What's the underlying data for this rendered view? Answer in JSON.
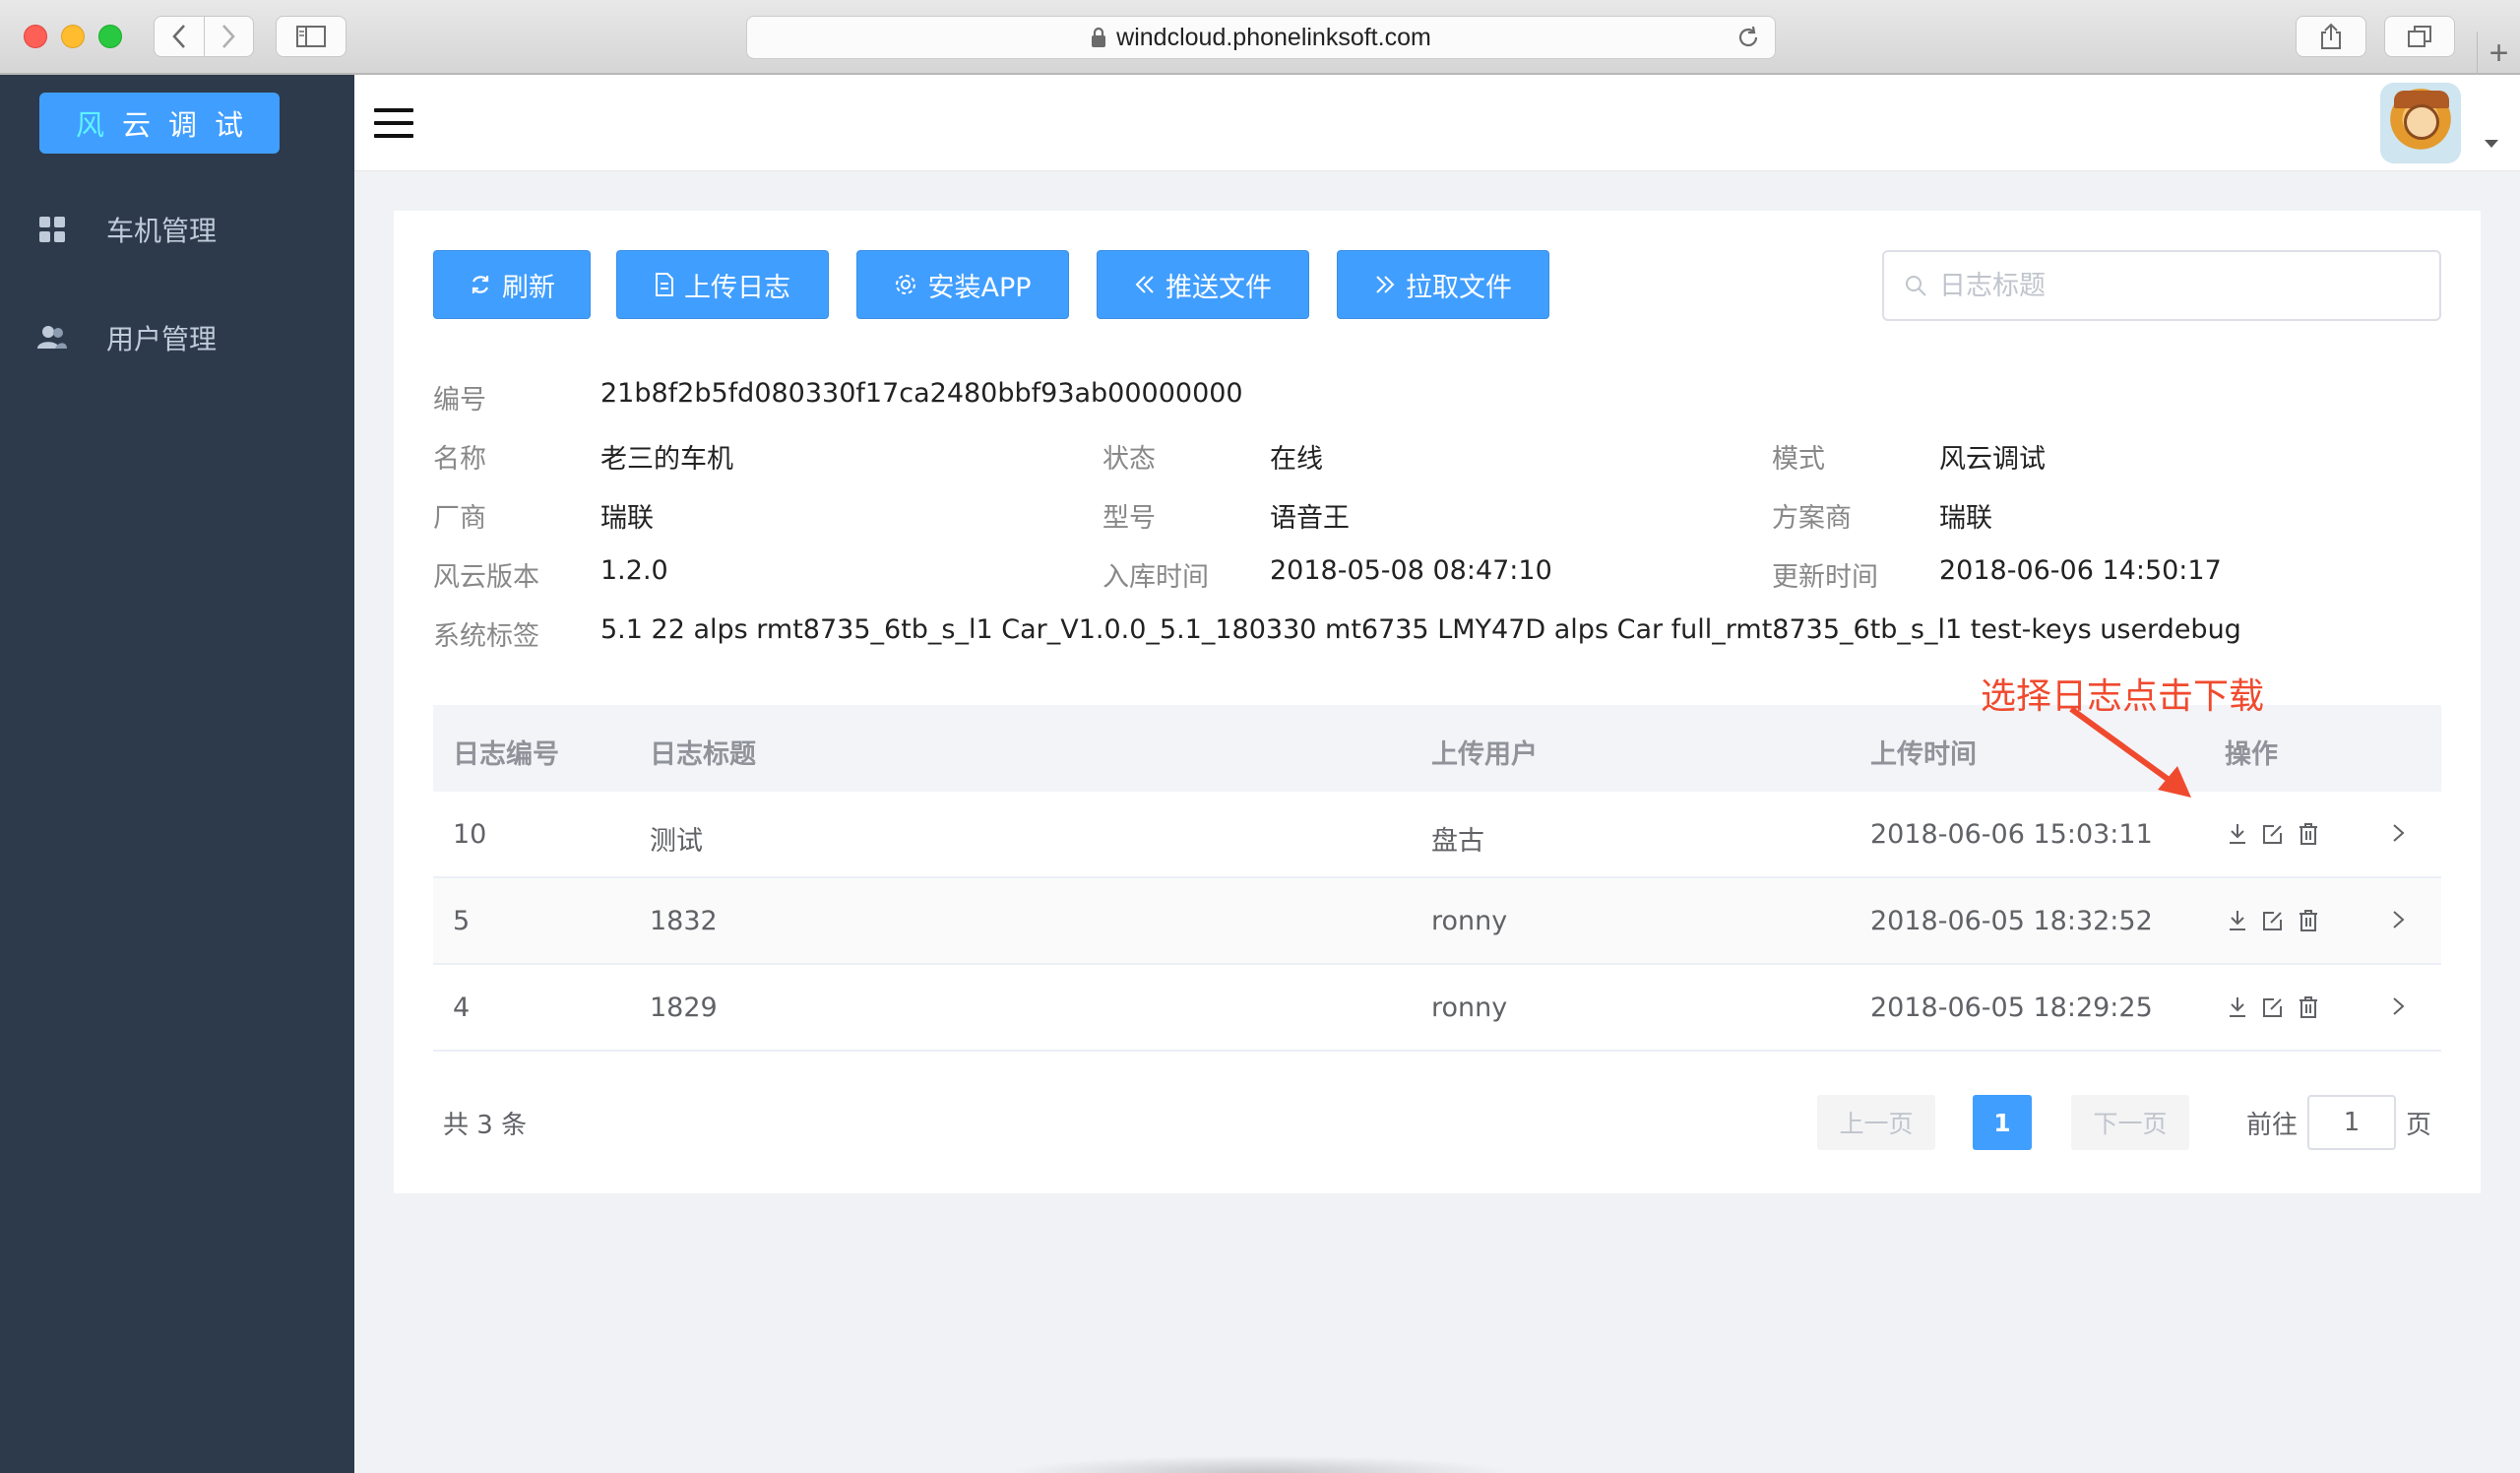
{
  "browser": {
    "url": "windcloud.phonelinksoft.com",
    "new_tab": "+"
  },
  "sidebar": {
    "brand": {
      "first": "风",
      "rest": "云调试"
    },
    "items": [
      {
        "label": "车机管理",
        "icon": "grid-icon"
      },
      {
        "label": "用户管理",
        "icon": "users-icon"
      }
    ]
  },
  "toolbar": {
    "refresh": "刷新",
    "upload_log": "上传日志",
    "install_app": "安装APP",
    "push_file": "推送文件",
    "pull_file": "拉取文件",
    "search_placeholder": "日志标题"
  },
  "device": {
    "id_label": "编号",
    "id_value": "21b8f2b5fd080330f17ca2480bbf93ab00000000",
    "name_label": "名称",
    "name_value": "老三的车机",
    "status_label": "状态",
    "status_value": "在线",
    "mode_label": "模式",
    "mode_value": "风云调试",
    "vendor_label": "厂商",
    "vendor_value": "瑞联",
    "model_label": "型号",
    "model_value": "语音王",
    "solution_label": "方案商",
    "solution_value": "瑞联",
    "version_label": "风云版本",
    "version_value": "1.2.0",
    "stock_time_label": "入库时间",
    "stock_time_value": "2018-05-08 08:47:10",
    "update_time_label": "更新时间",
    "update_time_value": "2018-06-06 14:50:17",
    "tags_label": "系统标签",
    "tags_value": "5.1 22 alps rmt8735_6tb_s_l1 Car_V1.0.0_5.1_180330 mt6735 LMY47D alps Car full_rmt8735_6tb_s_l1 test-keys userdebug"
  },
  "annotation": "选择日志点击下载",
  "table": {
    "headers": [
      "日志编号",
      "日志标题",
      "上传用户",
      "上传时间",
      "操作"
    ],
    "rows": [
      {
        "id": "10",
        "title": "测试",
        "user": "盘古",
        "time": "2018-06-06 15:03:11"
      },
      {
        "id": "5",
        "title": "1832",
        "user": "ronny",
        "time": "2018-06-05 18:32:52"
      },
      {
        "id": "4",
        "title": "1829",
        "user": "ronny",
        "time": "2018-06-05 18:29:25"
      }
    ]
  },
  "pagination": {
    "total": "共 3 条",
    "prev": "上一页",
    "current": "1",
    "next": "下一页",
    "goto_prefix": "前往",
    "goto_value": "1",
    "goto_suffix": "页"
  },
  "colors": {
    "primary": "#409eff",
    "sidebar_bg": "#2d3a4b",
    "annotation": "#f04a2e"
  }
}
